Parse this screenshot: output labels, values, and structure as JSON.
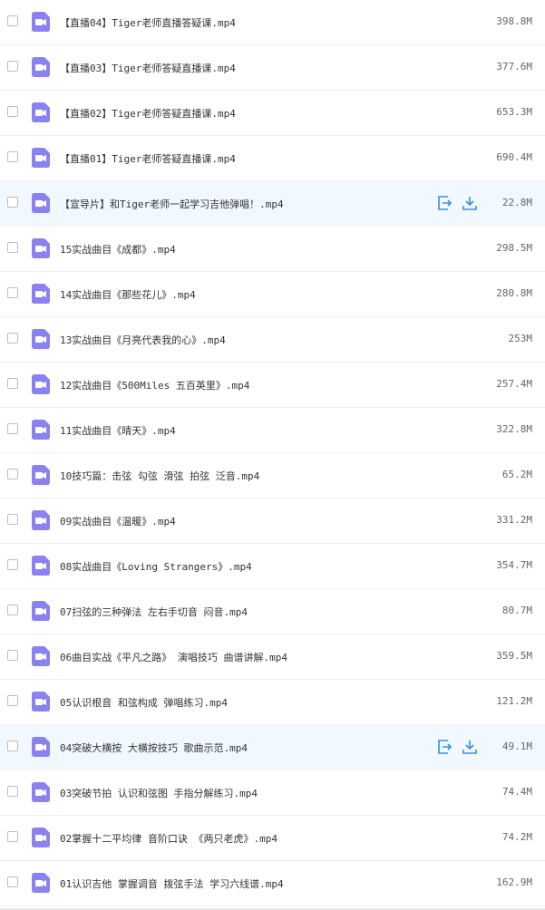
{
  "colors": {
    "icon_bg": "#8a82f0",
    "action_blue": "#3a8ee6",
    "hover_bg": "#f2f8ff"
  },
  "files": [
    {
      "name": "【直播04】Tiger老师直播答疑课.mp4",
      "size": "398.8M",
      "hovered": false
    },
    {
      "name": "【直播03】Tiger老师答疑直播课.mp4",
      "size": "377.6M",
      "hovered": false
    },
    {
      "name": "【直播02】Tiger老师答疑直播课.mp4",
      "size": "653.3M",
      "hovered": false
    },
    {
      "name": "【直播01】Tiger老师答疑直播课.mp4",
      "size": "690.4M",
      "hovered": false
    },
    {
      "name": "【宣导片】和Tiger老师一起学习吉他弹唱！.mp4",
      "size": "22.8M",
      "hovered": true
    },
    {
      "name": "15实战曲目《成都》.mp4",
      "size": "298.5M",
      "hovered": false
    },
    {
      "name": "14实战曲目《那些花儿》.mp4",
      "size": "280.8M",
      "hovered": false
    },
    {
      "name": "13实战曲目《月亮代表我的心》.mp4",
      "size": "253M",
      "hovered": false
    },
    {
      "name": "12实战曲目《500Miles 五百英里》.mp4",
      "size": "257.4M",
      "hovered": false
    },
    {
      "name": "11实战曲目《晴天》.mp4",
      "size": "322.8M",
      "hovered": false
    },
    {
      "name": "10技巧篇：击弦 勾弦 滑弦 拍弦 泛音.mp4",
      "size": "65.2M",
      "hovered": false
    },
    {
      "name": "09实战曲目《温暖》.mp4",
      "size": "331.2M",
      "hovered": false
    },
    {
      "name": "08实战曲目《Loving Strangers》.mp4",
      "size": "354.7M",
      "hovered": false
    },
    {
      "name": "07扫弦的三种弹法 左右手切音 闷音.mp4",
      "size": "80.7M",
      "hovered": false
    },
    {
      "name": "06曲目实战《平凡之路》 演唱技巧 曲谱讲解.mp4",
      "size": "359.5M",
      "hovered": false
    },
    {
      "name": "05认识根音 和弦构成 弹唱练习.mp4",
      "size": "121.2M",
      "hovered": false
    },
    {
      "name": "04突破大横按 大横按技巧 歌曲示范.mp4",
      "size": "49.1M",
      "hovered": true
    },
    {
      "name": "03突破节拍 认识和弦图 手指分解练习.mp4",
      "size": "74.4M",
      "hovered": false
    },
    {
      "name": "02掌握十二平均律 音阶口诀 《两只老虎》.mp4",
      "size": "74.2M",
      "hovered": false
    },
    {
      "name": "01认识吉他 掌握调音 拨弦手法 学习六线谱.mp4",
      "size": "162.9M",
      "hovered": false
    }
  ]
}
